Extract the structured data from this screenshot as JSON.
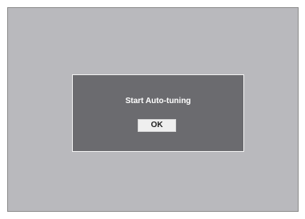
{
  "dialog": {
    "message": "Start Auto-tuning",
    "ok_label": "OK"
  },
  "colors": {
    "screen_background": "#b9b9bd",
    "dialog_background": "#6b6b6f",
    "dialog_border": "#f2f2f2",
    "button_background": "#efefef"
  }
}
